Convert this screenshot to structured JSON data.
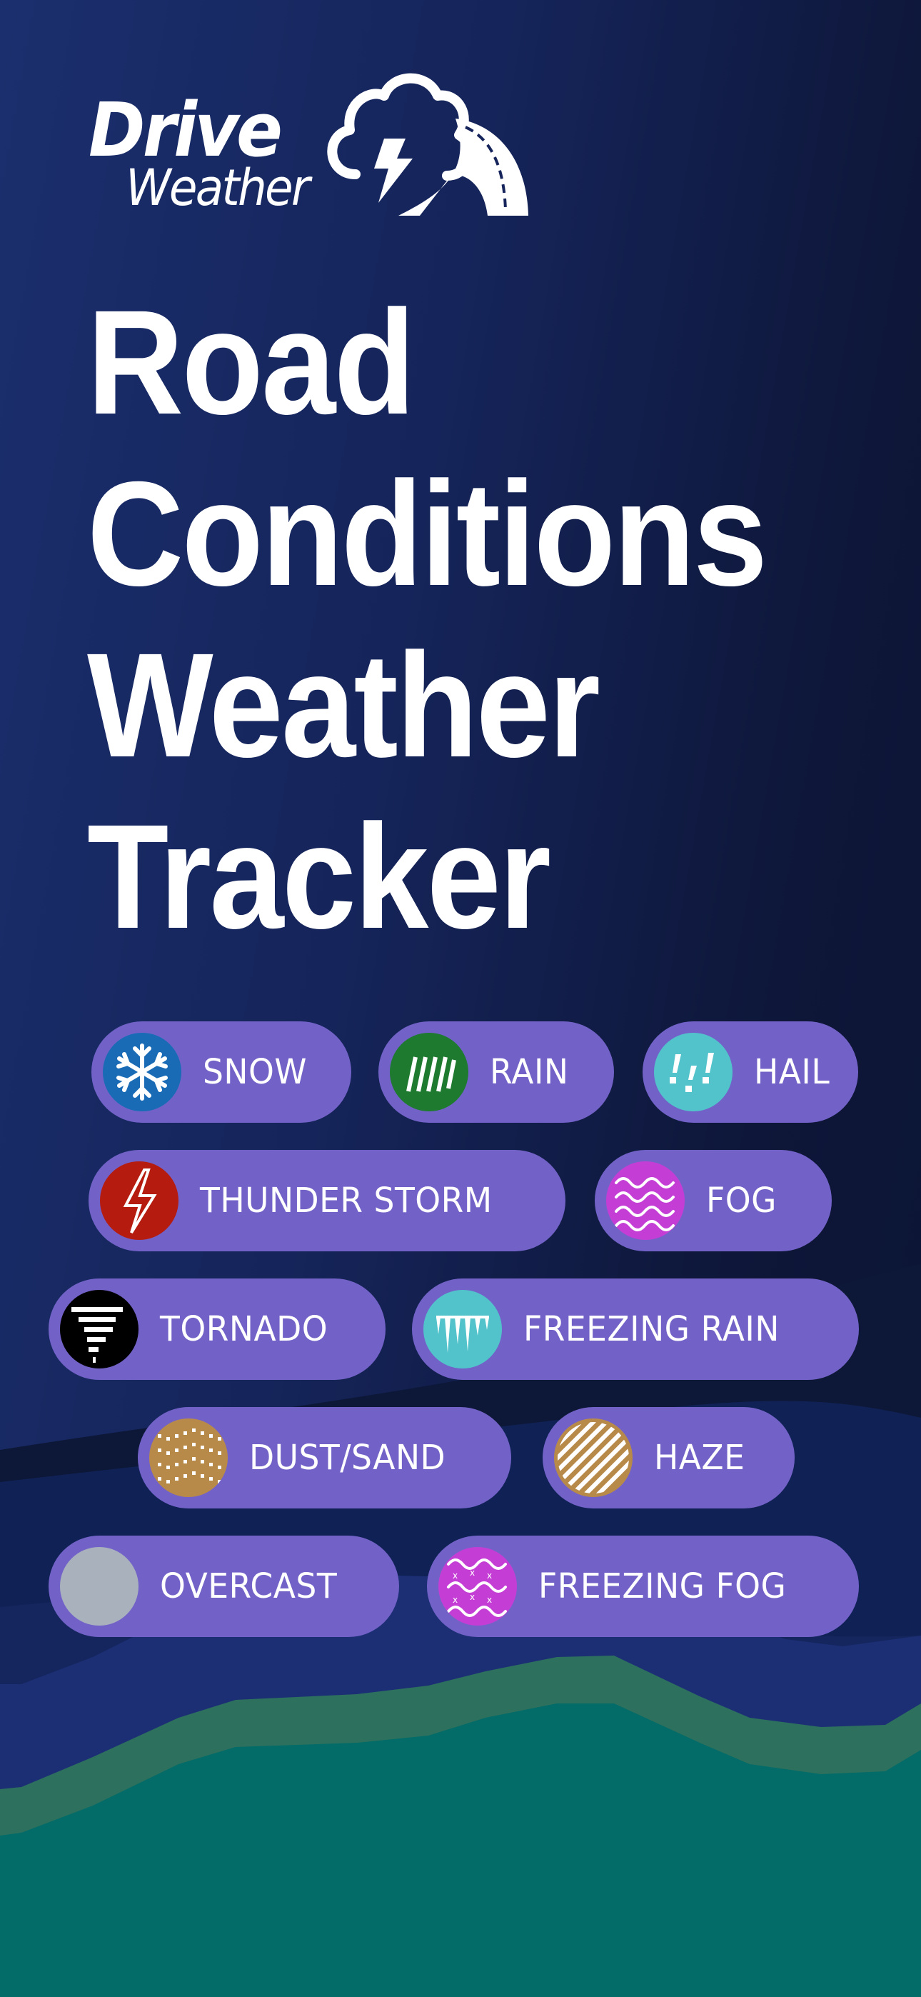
{
  "brand": {
    "name_line1": "Drive",
    "name_line2": "Weather",
    "logo_icon": "storm-cloud-road-icon"
  },
  "headline": {
    "lines": [
      "Road",
      "Conditions",
      "Weather",
      "Tracker"
    ]
  },
  "conditions": [
    {
      "label": "SNOW",
      "icon": "snowflake-icon",
      "color": "#1a6bb5"
    },
    {
      "label": "RAIN",
      "icon": "rain-streaks-icon",
      "color": "#1e7a2e"
    },
    {
      "label": "HAIL",
      "icon": "hail-icon",
      "color": "#52c3cb"
    },
    {
      "label": "THUNDER STORM",
      "icon": "lightning-bolt-icon",
      "color": "#b51b0e"
    },
    {
      "label": "FOG",
      "icon": "fog-waves-icon",
      "color": "#c43ed6"
    },
    {
      "label": "TORNADO",
      "icon": "tornado-icon",
      "color": "#000000"
    },
    {
      "label": "FREEZING RAIN",
      "icon": "icicles-icon",
      "color": "#52c3cb"
    },
    {
      "label": "DUST/SAND",
      "icon": "dust-dots-icon",
      "color": "#b88a4a"
    },
    {
      "label": "HAZE",
      "icon": "haze-stripes-icon",
      "color": "#b88a4a"
    },
    {
      "label": "OVERCAST",
      "icon": "overcast-circle-icon",
      "color": "#a9b1bd"
    },
    {
      "label": "FREEZING FOG",
      "icon": "freezing-fog-icon",
      "color": "#c43ed6"
    }
  ],
  "colors": {
    "chip_bg": "#7262c8",
    "bg_dark": "#0e1739",
    "bg_mid": "#1b2f6e",
    "wave_navy": "#1c2f75",
    "wave_green": "#2d705d",
    "wave_teal": "#036b68"
  }
}
